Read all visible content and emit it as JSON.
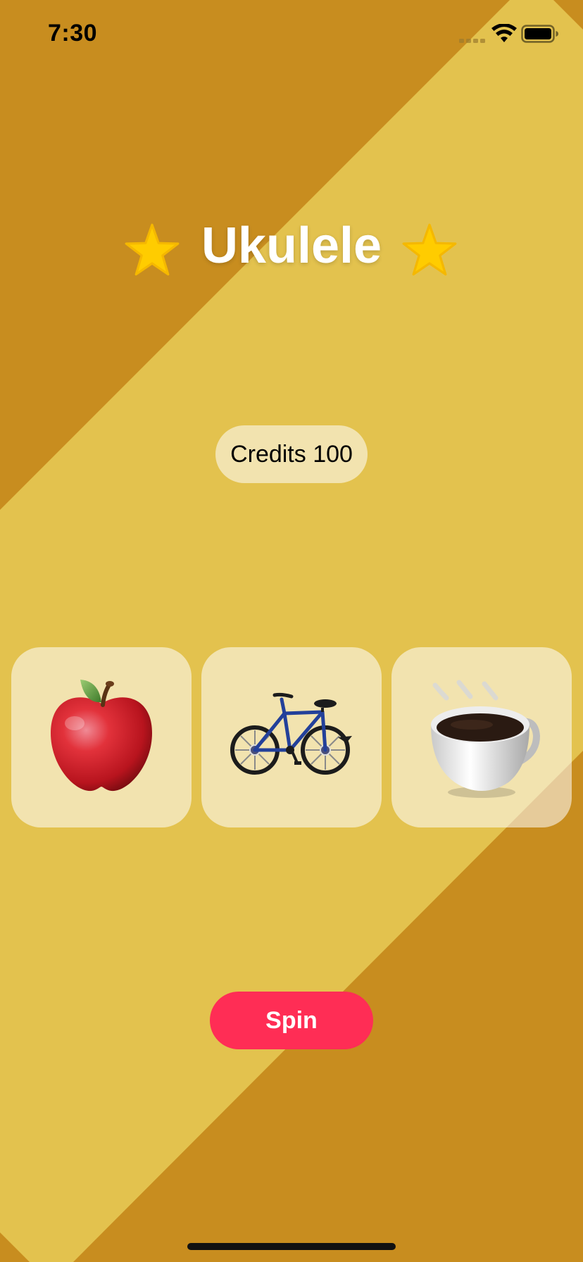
{
  "status_bar": {
    "time": "7:30",
    "signal_icon": "cellular-signal-icon",
    "wifi_icon": "wifi-icon",
    "battery_icon": "battery-icon"
  },
  "header": {
    "title": "Ukulele",
    "left_icon": "star-icon",
    "right_icon": "star-icon"
  },
  "credits": {
    "label": "Credits 100"
  },
  "reels": [
    {
      "symbol": "apple-icon"
    },
    {
      "symbol": "bicycle-icon"
    },
    {
      "symbol": "hot-beverage-icon"
    }
  ],
  "actions": {
    "spin_label": "Spin"
  },
  "colors": {
    "background_dark": "#C88D1F",
    "background_light": "#E3C24E",
    "accent": "#FF2D55",
    "star": "#FFCC00"
  }
}
